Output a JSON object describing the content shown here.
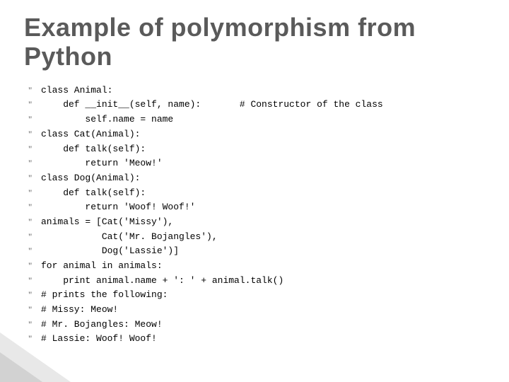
{
  "title": "Example of polymorphism from Python",
  "bullet_glyph": "\"",
  "lines": [
    "class Animal:",
    "    def __init__(self, name):       # Constructor of the class",
    "        self.name = name",
    "class Cat(Animal):",
    "    def talk(self):",
    "        return 'Meow!'",
    "class Dog(Animal):",
    "    def talk(self):",
    "        return 'Woof! Woof!'",
    "animals = [Cat('Missy'),",
    "           Cat('Mr. Bojangles'),",
    "           Dog('Lassie')]",
    "for animal in animals:",
    "    print animal.name + ': ' + animal.talk()",
    "# prints the following:",
    "# Missy: Meow!",
    "# Mr. Bojangles: Meow!",
    "# Lassie: Woof! Woof!"
  ]
}
